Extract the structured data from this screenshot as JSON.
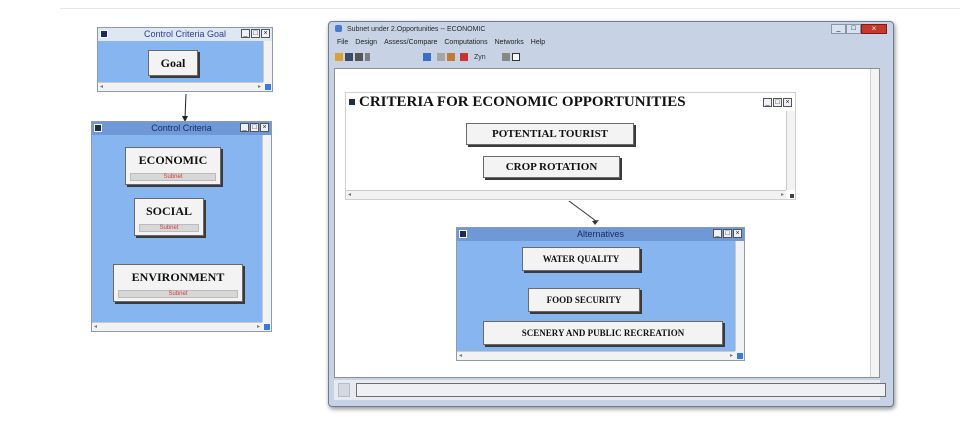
{
  "goal_window": {
    "title": "Control Criteria Goal",
    "node": "Goal"
  },
  "control_window": {
    "title": "Control Criteria",
    "nodes": [
      {
        "label": "ECONOMIC",
        "sub": "Subnet"
      },
      {
        "label": "SOCIAL",
        "sub": "Subnet"
      },
      {
        "label": "ENVIRONMENT",
        "sub": "Subnet"
      }
    ]
  },
  "main_window": {
    "title": "Subnet under 2.Opportunities  -- ECONOMIC",
    "menu": [
      "File",
      "Design",
      "Assess/Compare",
      "Computations",
      "Networks",
      "Help"
    ],
    "toolbar_text": "Zyn"
  },
  "criteria_window": {
    "title": "CRITERIA FOR ECONOMIC OPPORTUNITIES",
    "nodes": [
      "POTENTIAL TOURIST",
      "CROP ROTATION"
    ]
  },
  "alternatives_window": {
    "title": "Alternatives",
    "nodes": [
      "WATER QUALITY",
      "FOOD SECURITY",
      "SCENERY AND PUBLIC RECREATION"
    ]
  },
  "colors": {
    "panel_blue": "#87b5ef",
    "subnet_red": "#d43a3a",
    "close_red": "#c8372d"
  }
}
